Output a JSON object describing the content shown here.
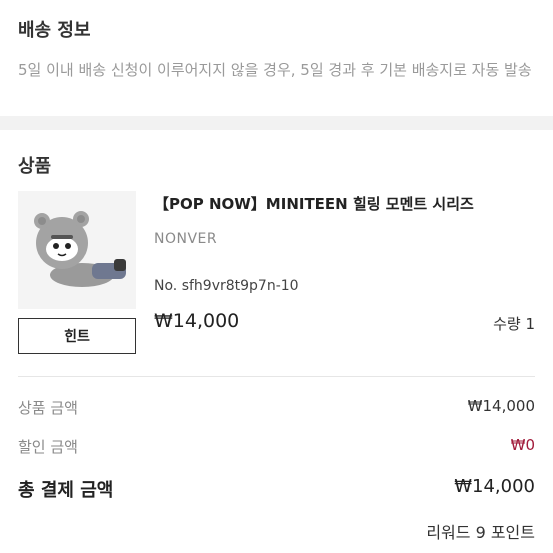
{
  "shipping": {
    "title": "배송 정보",
    "description": "5일 이내 배송 신청이 이루어지지 않을 경우, 5일 경과 후 기본 배송지로 자동 발송"
  },
  "product_section": {
    "title": "상품",
    "hint_button": "힌트",
    "item": {
      "name": "【POP NOW】MINITEEN 힐링 모멘트 시리즈",
      "brand": "NONVER",
      "number": "No. sfh9vr8t9p7n-10",
      "price": "₩14,000",
      "quantity": "수량 1"
    }
  },
  "summary": {
    "product_amount_label": "상품 금액",
    "product_amount_value": "₩14,000",
    "discount_label": "할인 금액",
    "discount_value": "₩0",
    "discount_color": "#a11a3a",
    "total_label": "총 결제 금액",
    "total_value": "₩14,000",
    "reward": "리워드 9 포인트"
  }
}
